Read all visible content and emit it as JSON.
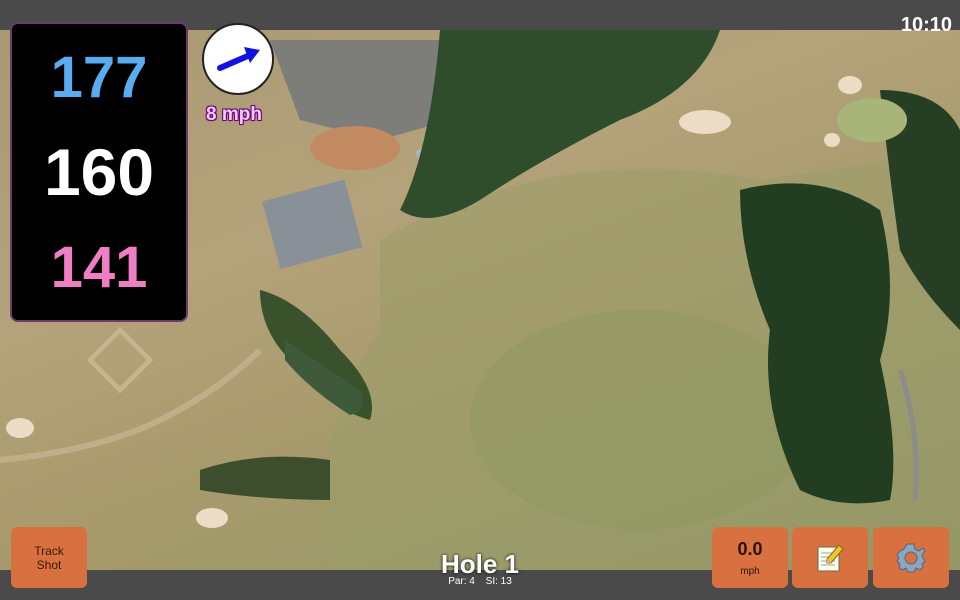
{
  "status_bar": {
    "time": "10:10"
  },
  "yardages": {
    "back": "177",
    "middle": "160",
    "front": "141"
  },
  "wind": {
    "speed_label": "8 mph",
    "icon": "arrow-icon"
  },
  "buttons": {
    "track_shot_line1": "Track",
    "track_shot_line2": "Shot",
    "speed_value": "0.0",
    "speed_unit": "mph",
    "notes_icon": "notepad-icon",
    "settings_icon": "gear-icon"
  },
  "hole": {
    "title": "Hole 1",
    "par_label": "Par: 4",
    "si_label": "SI: 13"
  },
  "colors": {
    "back_yardage": "#5aacf0",
    "middle_yardage": "#ffffff",
    "front_yardage": "#f07ec4",
    "button": "#d8713f",
    "wind_arrow": "#1010e0"
  }
}
